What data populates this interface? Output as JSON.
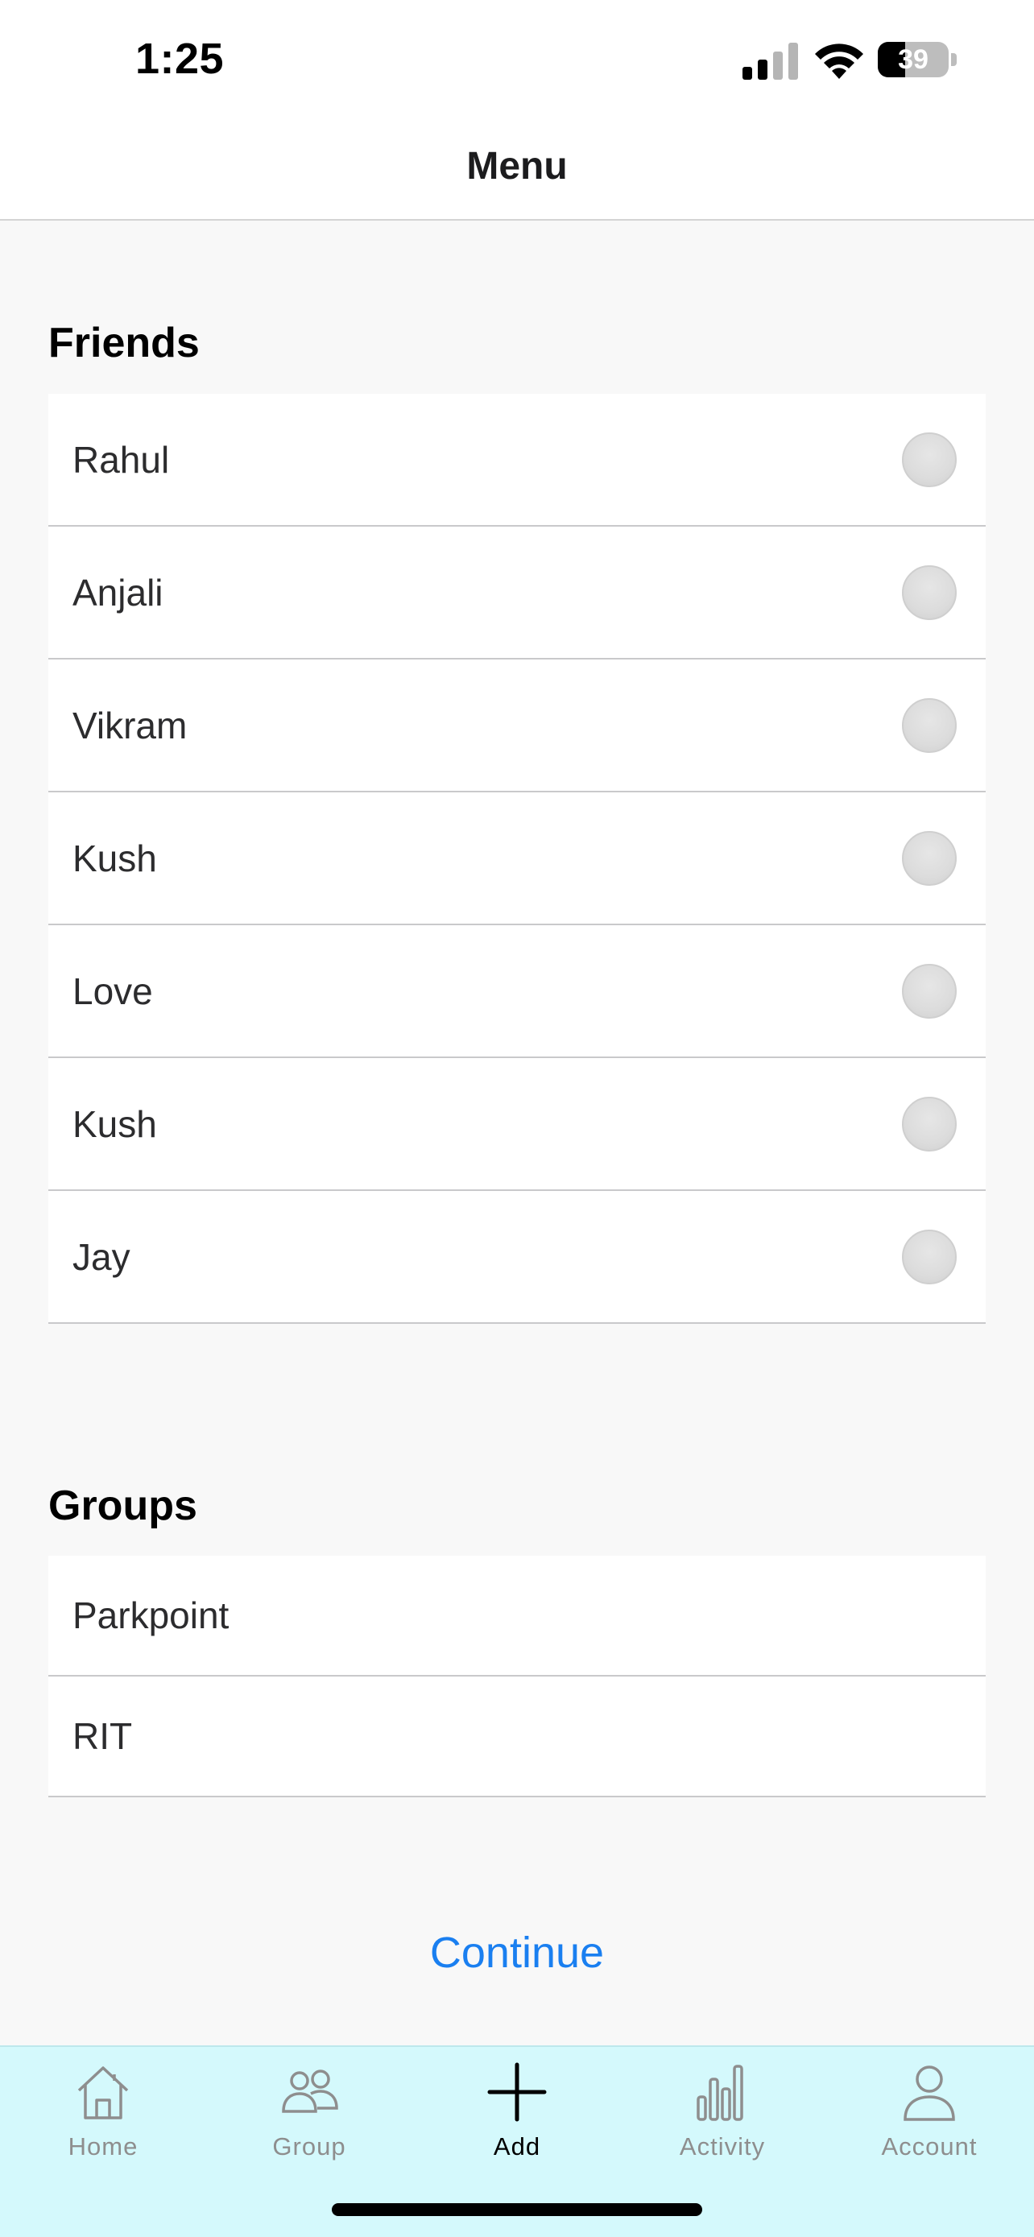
{
  "status_bar": {
    "time": "1:25",
    "battery_level": "39",
    "battery_fraction": 0.39
  },
  "nav": {
    "title": "Menu"
  },
  "friends": {
    "title": "Friends",
    "items": [
      {
        "label": "Rahul"
      },
      {
        "label": "Anjali"
      },
      {
        "label": "Vikram"
      },
      {
        "label": "Kush"
      },
      {
        "label": "Love"
      },
      {
        "label": "Kush"
      },
      {
        "label": "Jay"
      }
    ]
  },
  "groups": {
    "title": "Groups",
    "items": [
      {
        "label": "Parkpoint"
      },
      {
        "label": "RIT"
      }
    ]
  },
  "continue_label": "Continue",
  "tabs": [
    {
      "label": "Home",
      "icon": "house-icon"
    },
    {
      "label": "Group",
      "icon": "people-icon"
    },
    {
      "label": "Add",
      "icon": "plus-icon",
      "active": true
    },
    {
      "label": "Activity",
      "icon": "bar-chart-icon"
    },
    {
      "label": "Account",
      "icon": "person-icon"
    }
  ],
  "colors": {
    "accent": "#1a7ff0",
    "tab_bar_bg": "#d4f9fc",
    "background": "#f8f8f8"
  }
}
